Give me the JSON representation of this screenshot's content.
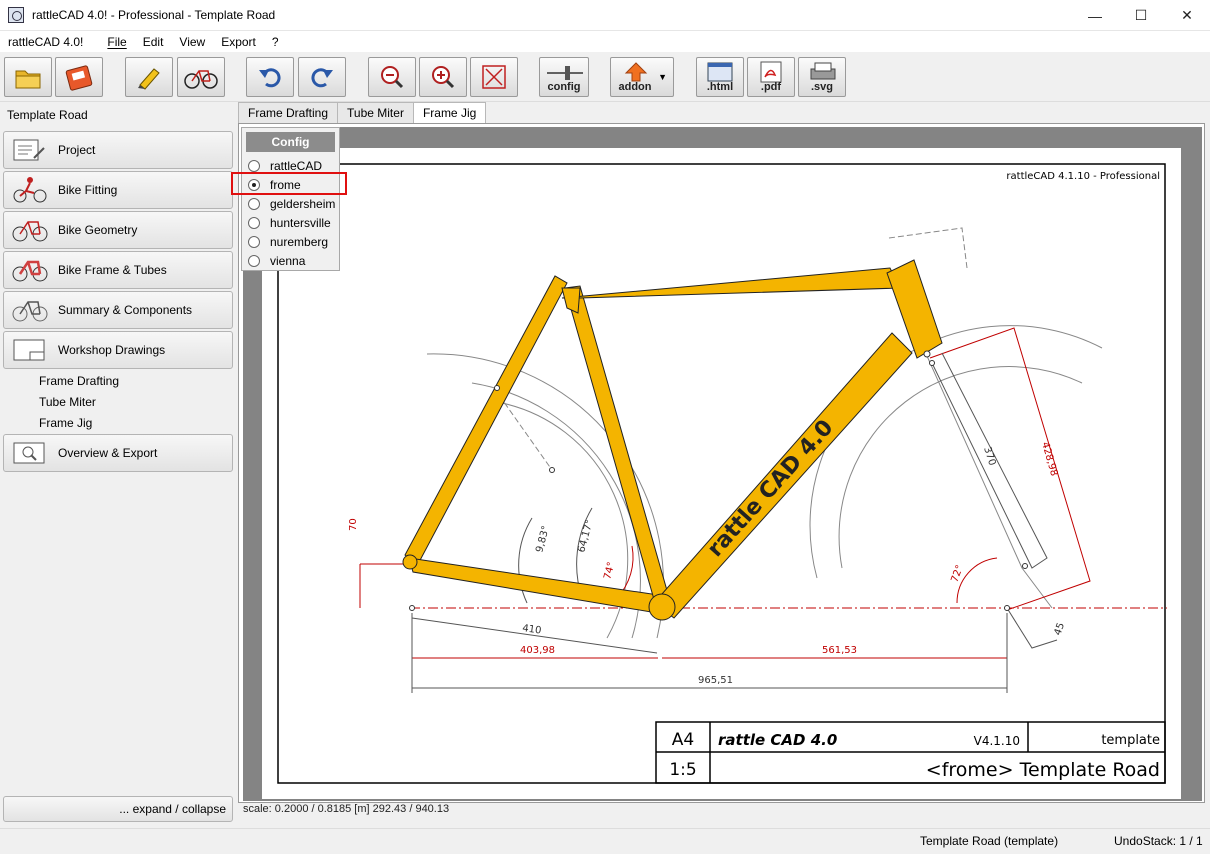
{
  "window": {
    "title": "rattleCAD 4.0! - Professional  - Template Road",
    "minimize": "—",
    "maximize": "☐",
    "close": "✕"
  },
  "menu": {
    "app": "rattleCAD 4.0!",
    "items": [
      "File",
      "Edit",
      "View",
      "Export",
      "?"
    ]
  },
  "toolbar": {
    "config_label": "config",
    "addon_label": "addon",
    "html_label": ".html",
    "pdf_label": ".pdf",
    "svg_label": ".svg"
  },
  "left_panel": {
    "title": "Template Road",
    "nav": [
      {
        "label": "Project",
        "icon": "project-icon"
      },
      {
        "label": "Bike Fitting",
        "icon": "bike-fitting-icon"
      },
      {
        "label": "Bike Geometry",
        "icon": "bike-geometry-icon"
      },
      {
        "label": "Bike Frame & Tubes",
        "icon": "bike-frame-icon"
      },
      {
        "label": "Summary & Components",
        "icon": "summary-icon"
      },
      {
        "label": "Workshop Drawings",
        "icon": "workshop-icon"
      }
    ],
    "sub_items": [
      "Frame Drafting",
      "Tube Miter",
      "Frame Jig"
    ],
    "overview": "Overview & Export",
    "expand": "... expand / collapse"
  },
  "tabs": [
    "Frame Drafting",
    "Tube Miter",
    "Frame Jig"
  ],
  "active_tab": 2,
  "config_menu": {
    "header": "Config",
    "options": [
      "rattleCAD",
      "frome",
      "geldersheim",
      "huntersville",
      "nuremberg",
      "vienna"
    ],
    "selected": 1
  },
  "drawing": {
    "header_note": "rattleCAD  4.1.10  -  Professional",
    "dims": {
      "d_70": "70",
      "d_410": "410",
      "d_40398": "403,98",
      "d_56153": "561,53",
      "d_96551": "965,51",
      "d_42898": "428,98",
      "d_370": "370",
      "d_45": "45",
      "a_983": "9,83°",
      "a_6417": "64,17°",
      "a_74": "74°",
      "a_72": "72°"
    },
    "frame_logo": "rattle CAD 4.0",
    "titleblock": {
      "size": "A4",
      "logo": "rattle CAD 4.0",
      "version": "V4.1.10",
      "kind": "template",
      "scale": "1:5",
      "name": "<frome>  Template Road"
    }
  },
  "scale_text": "scale: 0.2000 / 0.8185  [m]  292.43 / 940.13",
  "status": {
    "project": "Template Road (template)",
    "undo": "UndoStack:  1 /  1"
  },
  "colors": {
    "frame_tube": "#f4b400",
    "dimension_red": "#c00000",
    "highlight": "#e01010"
  }
}
